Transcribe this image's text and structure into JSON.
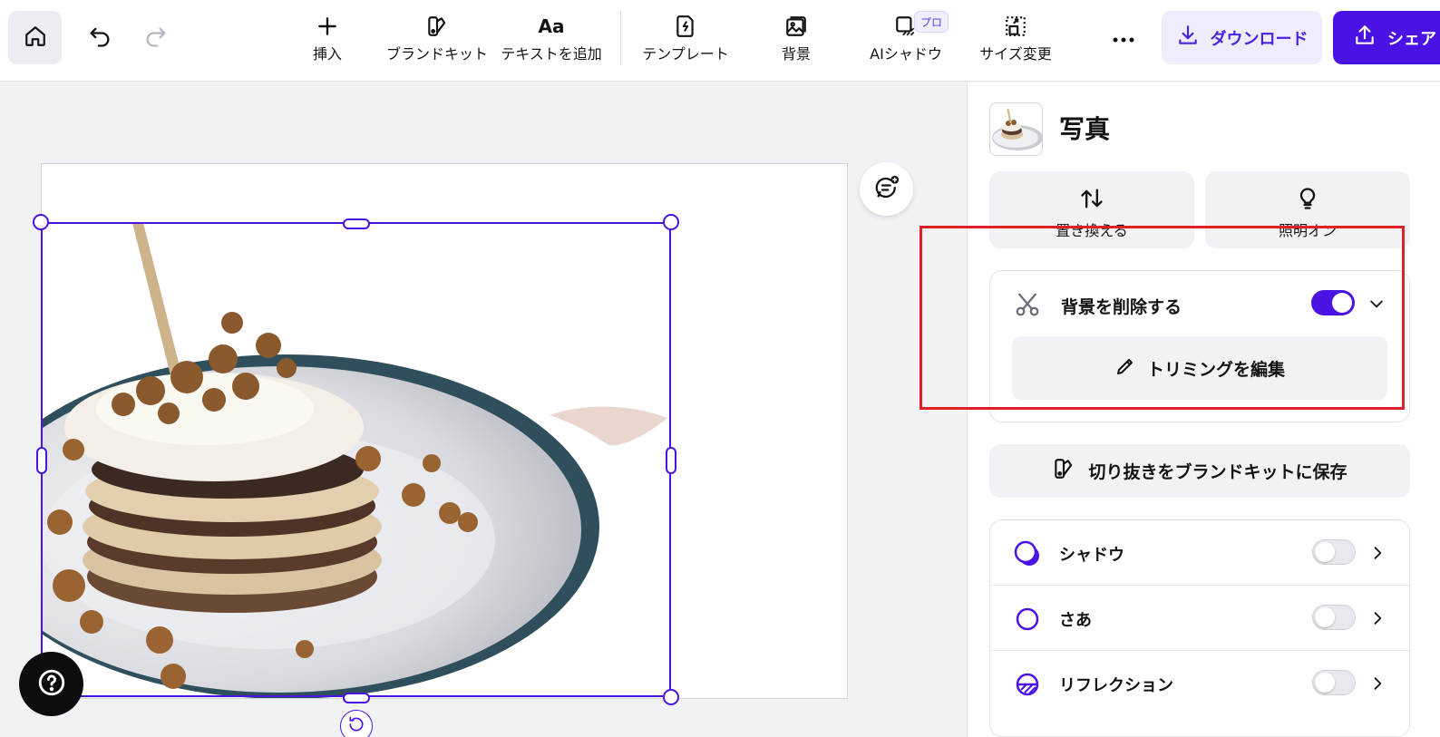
{
  "toolbar": {
    "home_icon": "home-icon",
    "undo_icon": "undo-icon",
    "redo_icon": "redo-icon",
    "tools": [
      {
        "label": "挿入",
        "icon": "plus-icon"
      },
      {
        "label": "ブランドキット",
        "icon": "brand-kit-icon"
      },
      {
        "label": "テキストを追加",
        "icon": "text-aa-icon"
      },
      {
        "label": "テンプレート",
        "icon": "template-icon"
      },
      {
        "label": "背景",
        "icon": "background-image-icon"
      },
      {
        "label": "AIシャドウ",
        "icon": "ai-shadow-icon"
      },
      {
        "label": "サイズ変更",
        "icon": "resize-icon"
      }
    ],
    "pro_badge": "プロ",
    "more_icon": "more-horizontal-icon",
    "download_label": "ダウンロード",
    "share_label": "シェア"
  },
  "panel": {
    "title": "写真",
    "replace_label": "置き換える",
    "lighting_label": "照明オン",
    "bg_remove": {
      "label": "背景を削除する",
      "enabled": true,
      "edit_trim_label": "トリミングを編集"
    },
    "save_cutout_label": "切り抜きをブランドキットに保存",
    "effects": [
      {
        "label": "シャドウ",
        "icon": "shadow-circle-icon",
        "enabled": false
      },
      {
        "label": "さあ",
        "icon": "outline-circle-icon",
        "enabled": false
      },
      {
        "label": "リフレクション",
        "icon": "reflection-icon",
        "enabled": false
      }
    ]
  },
  "colors": {
    "accent": "#4a13e3",
    "accent_soft": "#efedfd",
    "highlight": "#e11f26",
    "panel_bg": "#f1f2f6"
  }
}
